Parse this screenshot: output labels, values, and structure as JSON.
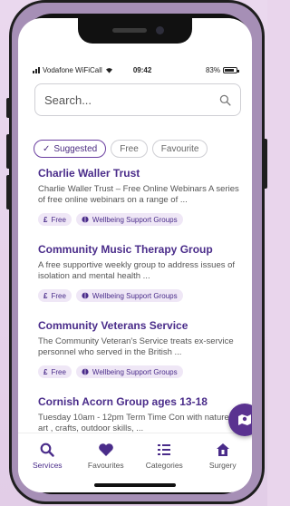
{
  "status_bar": {
    "carrier": "Vodafone WiFiCall",
    "time": "09:42",
    "battery": "83%",
    "battery_level": 0.83
  },
  "search": {
    "placeholder": "Search..."
  },
  "filters": [
    {
      "label": "Suggested",
      "active": true
    },
    {
      "label": "Free",
      "active": false
    },
    {
      "label": "Favourite",
      "active": false
    }
  ],
  "services": [
    {
      "title": "Charlie Waller Trust",
      "description": "Charlie Waller Trust – Free Online Webinars A series of free online webinars on a range of ...",
      "tags": [
        {
          "icon": "£",
          "label": "Free"
        },
        {
          "icon": "brain-icon",
          "label": "Wellbeing Support Groups"
        }
      ]
    },
    {
      "title": "Community Music Therapy Group",
      "description": "A free supportive weekly group to address issues of isolation and mental health ...",
      "tags": [
        {
          "icon": "£",
          "label": "Free"
        },
        {
          "icon": "brain-icon",
          "label": "Wellbeing Support Groups"
        }
      ]
    },
    {
      "title": "Community Veterans Service",
      "description": "The Community Veteran's Service treats ex-service personnel who served in the British ...",
      "tags": [
        {
          "icon": "£",
          "label": "Free"
        },
        {
          "icon": "brain-icon",
          "label": "Wellbeing Support Groups"
        }
      ]
    },
    {
      "title": "Cornish Acorn Group ages 13-18",
      "description": "Tuesday 10am - 12pm Term Time Con with nature , art , crafts, outdoor skills, ...",
      "tags": []
    }
  ],
  "nav": [
    {
      "label": "Services",
      "icon": "search-icon",
      "active": true
    },
    {
      "label": "Favourites",
      "icon": "heart-icon",
      "active": false
    },
    {
      "label": "Categories",
      "icon": "list-icon",
      "active": false
    },
    {
      "label": "Surgery",
      "icon": "house-icon",
      "active": false
    }
  ],
  "colors": {
    "accent": "#4a2c8a",
    "fab": "#5a3290",
    "tag_bg": "#efe7f6",
    "phone_body": "#a68fb6"
  }
}
